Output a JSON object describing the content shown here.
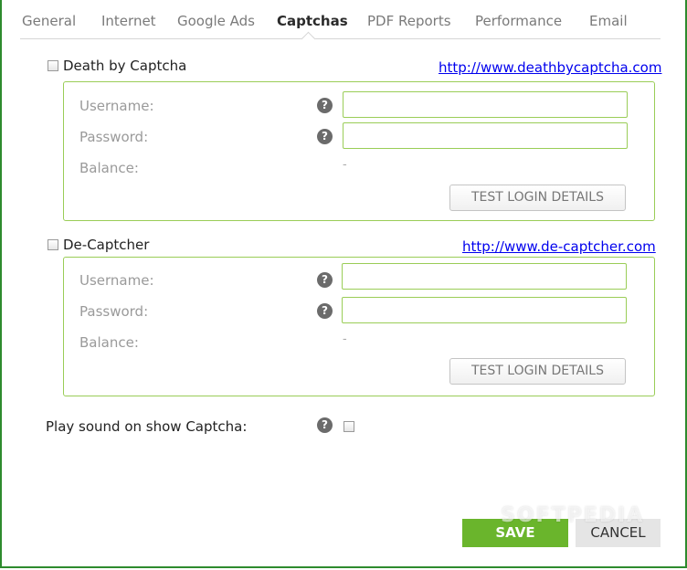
{
  "tabs": [
    {
      "label": "General"
    },
    {
      "label": "Internet"
    },
    {
      "label": "Google Ads"
    },
    {
      "label": "Captchas",
      "active": true
    },
    {
      "label": "PDF Reports"
    },
    {
      "label": "Performance"
    },
    {
      "label": "Email"
    }
  ],
  "deathbycaptcha": {
    "title": "Death by Captcha",
    "checked": false,
    "link": "http://www.deathbycaptcha.com",
    "username_label": "Username:",
    "username_value": "",
    "password_label": "Password:",
    "password_value": "",
    "balance_label": "Balance:",
    "balance_value": "-",
    "test_button": "TEST LOGIN DETAILS"
  },
  "decaptcher": {
    "title": "De-Captcher",
    "checked": false,
    "link": "http://www.de-captcher.com",
    "username_label": "Username:",
    "username_value": "",
    "password_label": "Password:",
    "password_value": "",
    "balance_label": "Balance:",
    "balance_value": "-",
    "test_button": "TEST LOGIN DETAILS"
  },
  "play_sound": {
    "label": "Play sound on show Captcha:",
    "checked": false
  },
  "help_glyph": "?",
  "footer": {
    "save_label": "SAVE",
    "cancel_label": "CANCEL"
  },
  "watermark": "SOFTPEDIA",
  "colors": {
    "accent_green": "#6ab52c",
    "frame_green": "#2e8b2e",
    "field_border": "#9acd57",
    "link": "#0000ee"
  }
}
